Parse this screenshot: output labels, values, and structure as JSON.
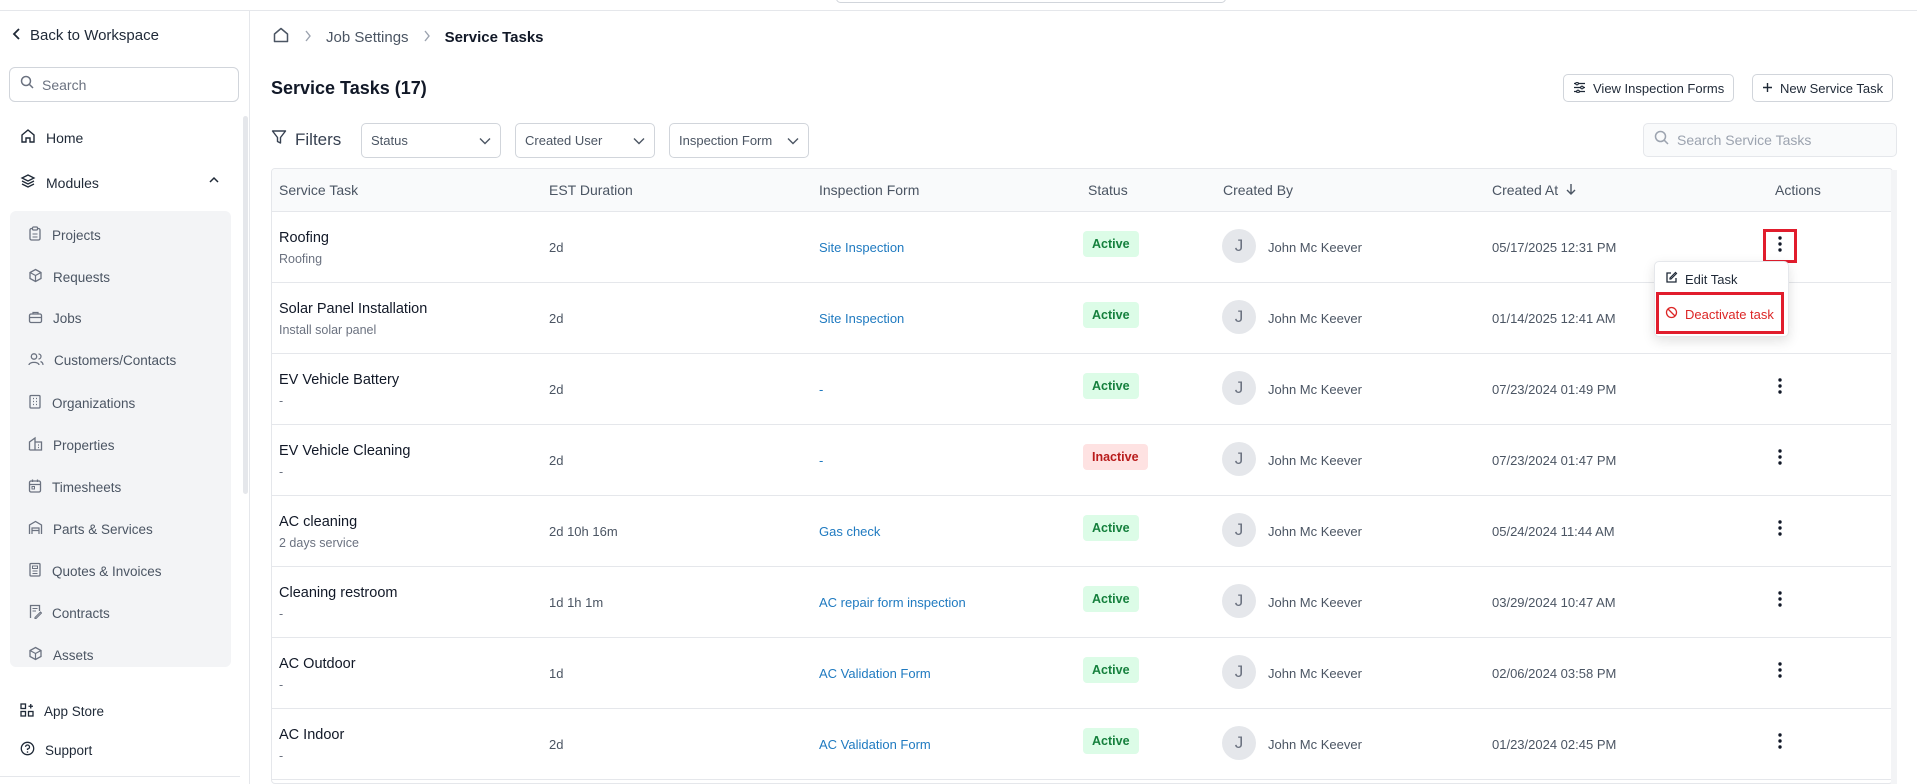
{
  "sidebar": {
    "back_label": "Back to Workspace",
    "search_placeholder": "Search",
    "home_label": "Home",
    "modules_label": "Modules",
    "modules": [
      {
        "label": "Projects"
      },
      {
        "label": "Requests"
      },
      {
        "label": "Jobs"
      },
      {
        "label": "Customers/Contacts"
      },
      {
        "label": "Organizations"
      },
      {
        "label": "Properties"
      },
      {
        "label": "Timesheets"
      },
      {
        "label": "Parts & Services"
      },
      {
        "label": "Quotes & Invoices"
      },
      {
        "label": "Contracts"
      },
      {
        "label": "Assets"
      }
    ],
    "app_store_label": "App Store",
    "support_label": "Support"
  },
  "breadcrumb": {
    "items": [
      "Job Settings",
      "Service Tasks"
    ]
  },
  "page": {
    "title": "Service Tasks (17)",
    "view_forms_label": "View Inspection Forms",
    "new_task_label": "New Service Task"
  },
  "filters": {
    "label": "Filters",
    "status": "Status",
    "created_user": "Created User",
    "inspection_form": "Inspection Form",
    "search_placeholder": "Search Service Tasks"
  },
  "table": {
    "headers": [
      "Service Task",
      "EST Duration",
      "Inspection Form",
      "Status",
      "Created By",
      "Created At",
      "Actions"
    ],
    "rows": [
      {
        "name": "Roofing",
        "sub": "Roofing",
        "duration": "2d",
        "form": "Site Inspection",
        "status": "Active",
        "avatar": "J",
        "creator": "John Mc Keever",
        "created": "05/17/2025 12:31 PM"
      },
      {
        "name": "Solar Panel Installation",
        "sub": "Install solar panel",
        "duration": "2d",
        "form": "Site Inspection",
        "status": "Active",
        "avatar": "J",
        "creator": "John Mc Keever",
        "created": "01/14/2025 12:41 AM"
      },
      {
        "name": "EV Vehicle Battery",
        "sub": "-",
        "duration": "2d",
        "form": "-",
        "status": "Active",
        "avatar": "J",
        "creator": "John Mc Keever",
        "created": "07/23/2024 01:49 PM"
      },
      {
        "name": "EV Vehicle Cleaning",
        "sub": "-",
        "duration": "2d",
        "form": "-",
        "status": "Inactive",
        "avatar": "J",
        "creator": "John Mc Keever",
        "created": "07/23/2024 01:47 PM"
      },
      {
        "name": "AC cleaning",
        "sub": "2 days service",
        "duration": "2d 10h 16m",
        "form": "Gas check",
        "status": "Active",
        "avatar": "J",
        "creator": "John Mc Keever",
        "created": "05/24/2024 11:44 AM"
      },
      {
        "name": "Cleaning restroom",
        "sub": "-",
        "duration": "1d 1h 1m",
        "form": "AC repair form inspection",
        "status": "Active",
        "avatar": "J",
        "creator": "John Mc Keever",
        "created": "03/29/2024 10:47 AM"
      },
      {
        "name": "AC Outdoor",
        "sub": "-",
        "duration": "1d",
        "form": "AC Validation Form",
        "status": "Active",
        "avatar": "J",
        "creator": "John Mc Keever",
        "created": "02/06/2024 03:58 PM"
      },
      {
        "name": "AC Indoor",
        "sub": "-",
        "duration": "2d",
        "form": "AC Validation Form",
        "status": "Active",
        "avatar": "J",
        "creator": "John Mc Keever",
        "created": "01/23/2024 02:45 PM"
      }
    ]
  },
  "action_menu": {
    "edit_label": "Edit Task",
    "deactivate_label": "Deactivate task"
  },
  "colors": {
    "link": "#1f7ac0",
    "active_badge_bg": "#dcfce7",
    "active_badge_text": "#15803d",
    "inactive_badge_bg": "#fee2e2",
    "inactive_badge_text": "#b91c1c",
    "highlight": "#e11d2d"
  }
}
